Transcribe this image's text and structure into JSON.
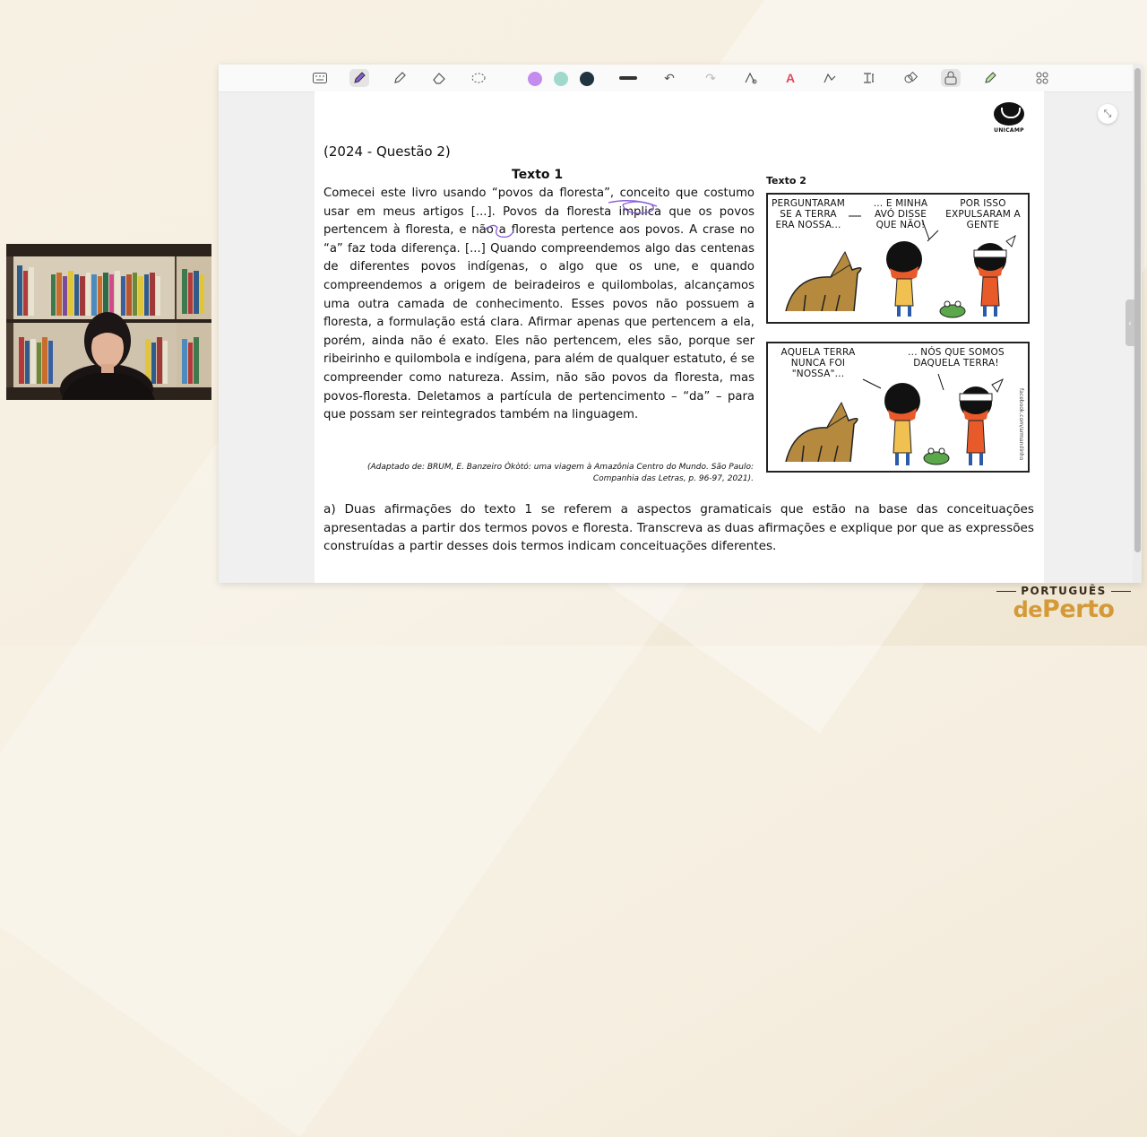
{
  "toolbar": {
    "icons": [
      "keyboard-icon",
      "pen-icon",
      "highlighter-icon",
      "eraser-icon",
      "lasso-icon",
      "undo-icon",
      "redo-icon",
      "shape-pen-icon",
      "text-color-icon",
      "shape-icon",
      "text-insert-icon",
      "shapes-icon",
      "lock-icon",
      "marker-icon",
      "apps-icon"
    ],
    "colors": [
      "#c58cf0",
      "#9fd9cc",
      "#1f3340"
    ]
  },
  "document": {
    "question_header": "(2024 - Questão 2)",
    "logo_text": "UNICAMP",
    "texto1_title": "Texto 1",
    "texto1_body": "Comecei este livro usando “povos da floresta”, conceito que costumo usar em meus artigos [...]. Povos da floresta implica que os povos pertencem à floresta, e não a floresta pertence aos povos. A crase no “a” faz toda diferença. [...] Quando compreendemos algo das centenas de diferentes povos indígenas, o algo que os une, e quando compreendemos a origem de beiradeiros e quilombolas, alcançamos uma outra camada de conhecimento. Esses povos não possuem a floresta, a formulação está clara. Afirmar apenas que pertencem a ela, porém, ainda não é exato. Eles não pertencem, eles são, porque ser ribeirinho e quilombola e indígena, para além de qualquer estatuto, é se compreender como natureza. Assim, não são povos da floresta, mas povos-floresta. Deletamos a partícula de pertencimento – “da” – para que possam ser reintegrados também na linguagem.",
    "reference_line1": "(Adaptado de: BRUM, E. Banzeiro Òkòtó: uma viagem à Amazônia Centro do Mundo. São Paulo:",
    "reference_line2": "Companhia das Letras, p. 96-97, 2021).",
    "texto2_title": "Texto 2",
    "comic": {
      "panel1": {
        "balloon1": "PERGUNTARAM SE A TERRA ERA NOSSA...",
        "balloon2": "... E MINHA AVÓ DISSE QUE NÃO!",
        "balloon3": "POR ISSO EXPULSARAM A GENTE"
      },
      "panel2": {
        "balloon1": "AQUELA TERRA NUNCA FOI \"NOSSA\"...",
        "balloon2": "... NÓS QUE SOMOS DAQUELA TERRA!",
        "credit": "facebook.com/armandinho"
      }
    },
    "question_a": "a) Duas afirmações do texto 1 se referem a aspectos gramaticais que estão na base das conceituações apresentadas a partir dos termos povos e floresta. Transcreva as duas afirmações e explique por que as expressões construídas a partir desses dois termos indicam conceituações diferentes."
  },
  "brand": {
    "top": "PORTUGUÊS",
    "main_de": "de",
    "main_perto": "Perto"
  }
}
